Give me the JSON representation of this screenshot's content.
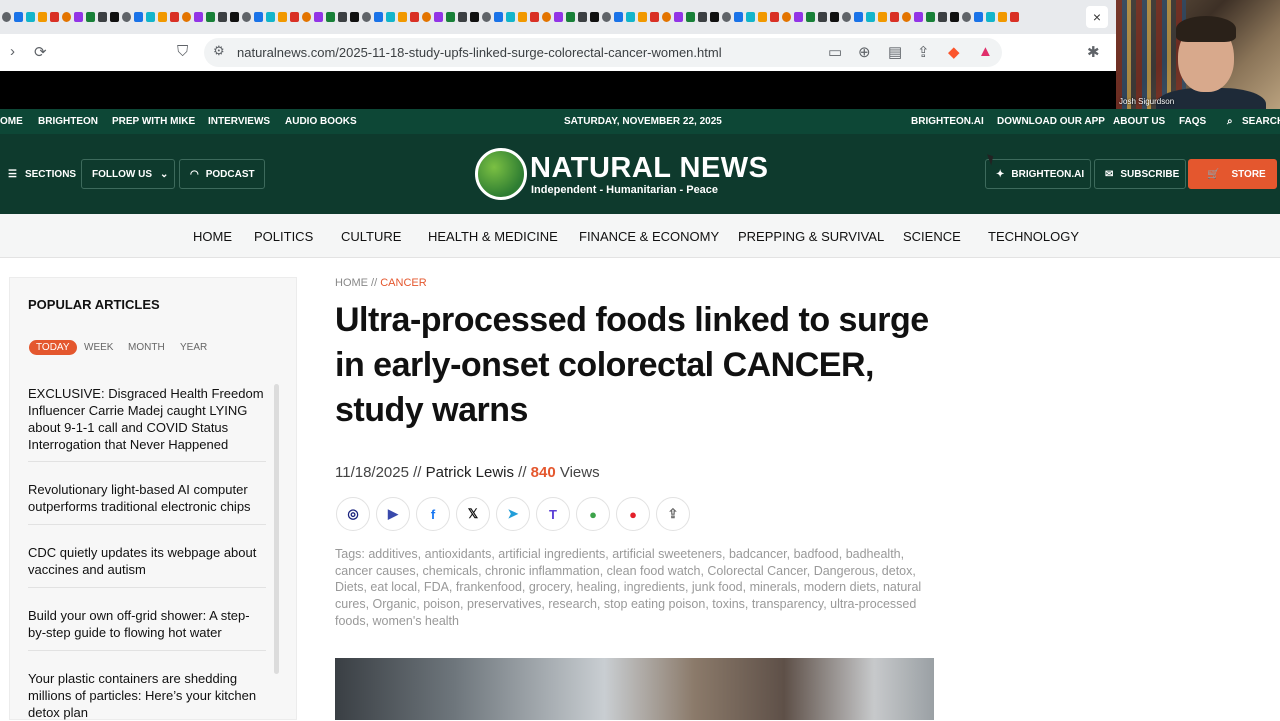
{
  "browser": {
    "url": "naturalnews.com/2025-11-18-study-upfs-linked-surge-colorectal-cancer-women.html",
    "tab_close": "×"
  },
  "webcam": {
    "name": "Josh Sigurdson"
  },
  "topnav": {
    "left": [
      "OME",
      "BRIGHTEON",
      "PREP WITH MIKE",
      "INTERVIEWS",
      "AUDIO BOOKS"
    ],
    "date": "SATURDAY, NOVEMBER 22, 2025",
    "right": [
      "BRIGHTEON.AI",
      "DOWNLOAD OUR APP",
      "ABOUT US",
      "FAQS",
      "SEARCH"
    ]
  },
  "header": {
    "sections": "SECTIONS",
    "follow": "FOLLOW US",
    "podcast": "PODCAST",
    "logo_title": "NATURAL NEWS",
    "logo_sub": "Independent - Humanitarian - Peace",
    "brighteon_ai": "BRIGHTEON.AI",
    "subscribe": "SUBSCRIBE",
    "store": "STORE"
  },
  "mainnav": [
    "HOME",
    "POLITICS",
    "CULTURE",
    "HEALTH & MEDICINE",
    "FINANCE & ECONOMY",
    "PREPPING & SURVIVAL",
    "SCIENCE",
    "TECHNOLOGY"
  ],
  "sidebar": {
    "title": "POPULAR ARTICLES",
    "tabs": [
      "TODAY",
      "WEEK",
      "MONTH",
      "YEAR"
    ],
    "items": [
      "EXCLUSIVE: Disgraced Health Freedom Influencer Carrie Madej caught LYING about 9-1-1 call and COVID Status Interrogation that Never Happened",
      "Revolutionary light-based AI computer outperforms traditional electronic chips",
      "CDC quietly updates its webpage about vaccines and autism",
      "Build your own off-grid shower: A step-by-step guide to flowing hot water",
      "Your plastic containers are shedding millions of particles: Here’s your kitchen detox plan"
    ]
  },
  "article": {
    "crumb_home": "HOME",
    "crumb_sep": " // ",
    "crumb_cat": "CANCER",
    "headline": "Ultra-processed foods linked to surge in early-onset colorectal CANCER, study warns",
    "date": "11/18/2025",
    "sep": " // ",
    "author": "Patrick Lewis",
    "views": "840",
    "views_label": " Views",
    "share": [
      "◎",
      "▶",
      "f",
      "𝕏",
      "➤",
      "T",
      "●",
      "●",
      "⇪"
    ],
    "tags": "Tags: additives, antioxidants, artificial ingredients, artificial sweeteners, badcancer, badfood, badhealth, cancer causes, chemicals, chronic inflammation, clean food watch, Colorectal Cancer, Dangerous, detox, Diets, eat local, FDA, frankenfood, grocery, healing, ingredients, junk food, minerals, modern diets, natural cures, Organic, poison, preservatives, research, stop eating poison, toxins, transparency, ultra-processed foods, women's health"
  },
  "colors": {
    "topnav": "#0d4736",
    "header": "#0e3a2d",
    "accent": "#e4572e"
  }
}
